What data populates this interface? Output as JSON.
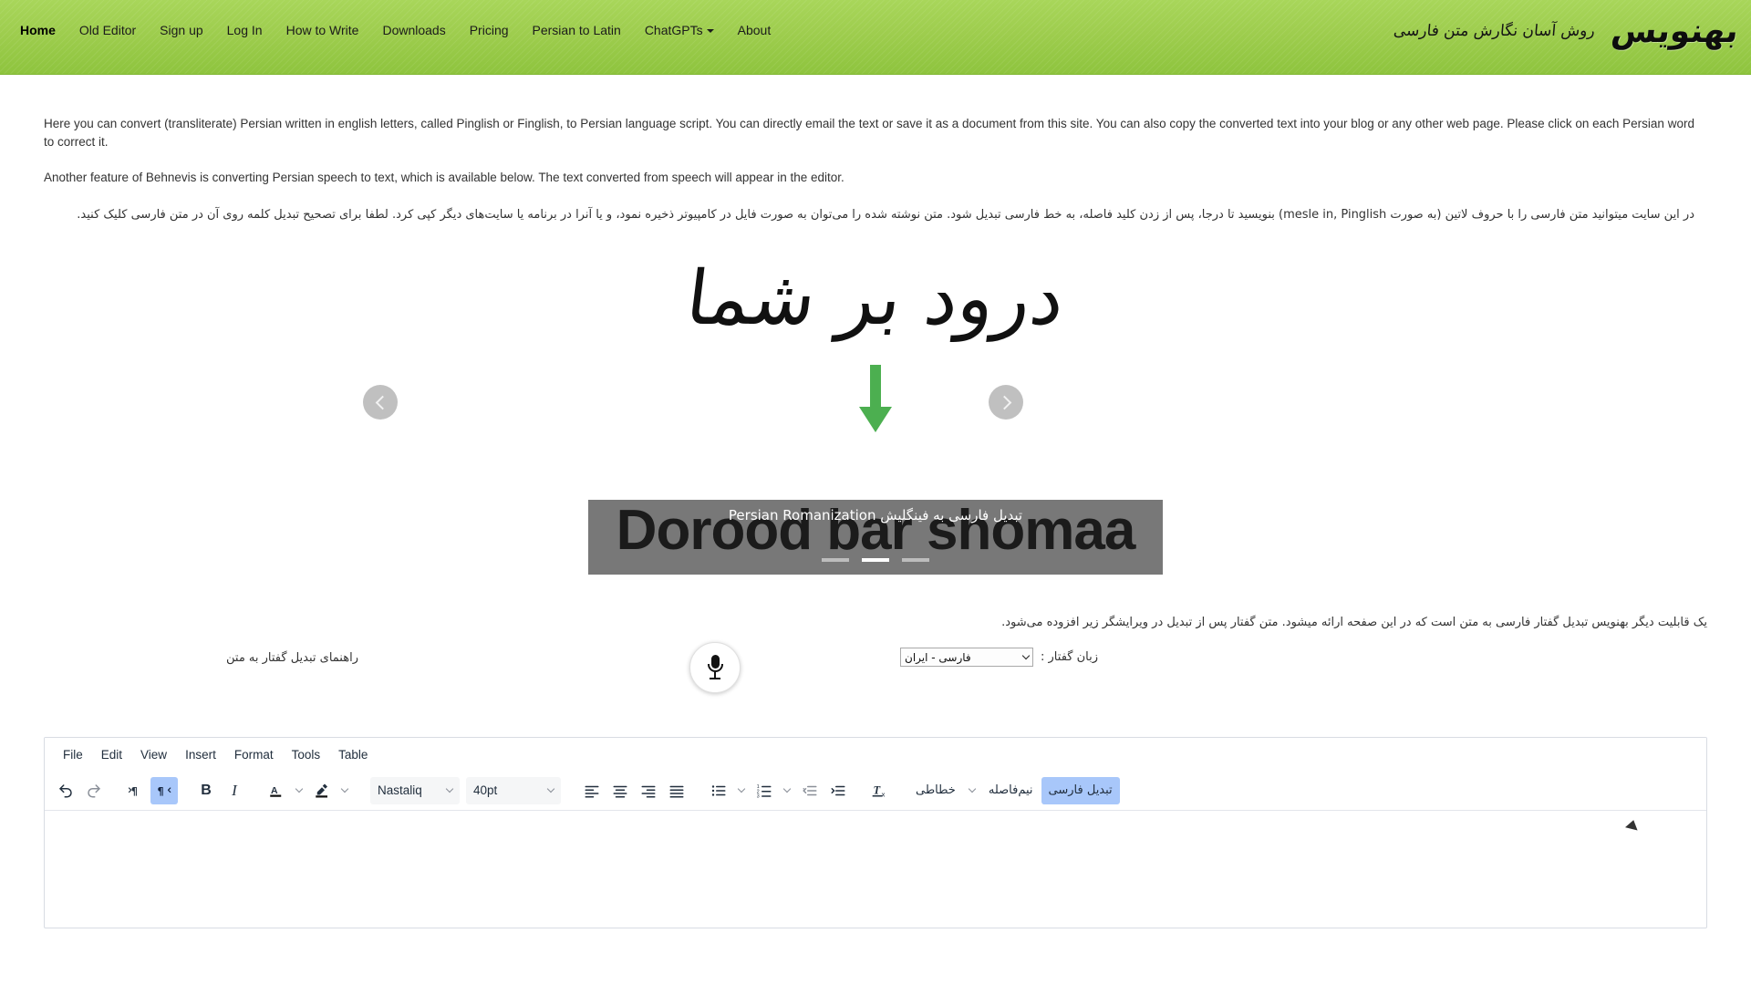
{
  "navbar": {
    "items": [
      {
        "label": "Home",
        "active": true,
        "dropdown": false
      },
      {
        "label": "Old Editor",
        "active": false,
        "dropdown": false
      },
      {
        "label": "Sign up",
        "active": false,
        "dropdown": false
      },
      {
        "label": "Log In",
        "active": false,
        "dropdown": false
      },
      {
        "label": "How to Write",
        "active": false,
        "dropdown": false
      },
      {
        "label": "Downloads",
        "active": false,
        "dropdown": false
      },
      {
        "label": "Pricing",
        "active": false,
        "dropdown": false
      },
      {
        "label": "Persian to Latin",
        "active": false,
        "dropdown": false
      },
      {
        "label": "ChatGPTs",
        "active": false,
        "dropdown": true
      },
      {
        "label": "About",
        "active": false,
        "dropdown": false
      }
    ],
    "brand": {
      "logo": "بهنویس",
      "tagline": "روش آسان نگارش متن فارسی"
    },
    "background_color": "#9ecd4e"
  },
  "intro": {
    "paragraph_1": "Here you can convert (transliterate) Persian written in english letters, called Pinglish or Finglish, to Persian language script. You can directly email the text or save it as a document from this site. You can also copy the converted text into your blog or any other web page. Please click on each Persian word to correct it.",
    "paragraph_2": "Another feature of Behnevis is converting Persian speech to text, which is available below. The text converted from speech will appear in the editor.",
    "paragraph_fa": "در این سایت میتوانید متن فارسی را با حروف لاتین (به صورت mesle in, Pinglish) بنویسید تا درجا، پس از زدن کلید فاصله، به خط فارسی تبدیل شود. متن نوشته شده را می‌توان به صورت فایل در کامپیوتر ذخیره نمود، و یا آنرا در برنامه یا سایت‌های دیگر کپی کرد. لطفا برای تصحیح تبدیل کلمه روی آن در متن فارسی کلیک کنید."
  },
  "carousel": {
    "slide_persian": "درود بر شما",
    "slide_caption_fa": "تبدیل فارسی به فینگلیش",
    "slide_caption_en": "Persian Romanization",
    "slide_romanization": "Dorood bar shomaa",
    "dots": [
      {
        "active": false
      },
      {
        "active": true
      },
      {
        "active": false
      }
    ],
    "prev_icon": "chevron-left-icon",
    "next_icon": "chevron-right-icon",
    "arrow_color": "#4caf50"
  },
  "speech": {
    "note_fa": "یک قابلیت دیگر بهنویس تبدیل گفتار فارسی به متن است که در این صفحه ارائه میشود. متن گفتار پس از تبدیل در ویرایشگر زیر افزوده می‌شود.",
    "guide_link_fa": "راهنمای تبدیل گفتار به متن",
    "mic_icon": "microphone-icon",
    "language_label_fa": "زبان گفتار :",
    "language_value_fa": "فارسی - ایران"
  },
  "editor": {
    "menus": [
      "File",
      "Edit",
      "View",
      "Insert",
      "Format",
      "Tools",
      "Table"
    ],
    "toolbar": {
      "undo_icon": "undo-icon",
      "redo_icon": "redo-icon",
      "ltr_icon": "ltr-paragraph-icon",
      "rtl_icon": "rtl-paragraph-icon",
      "rtl_active": true,
      "bold_label": "B",
      "italic_label": "I",
      "text_color_label": "A",
      "highlight_icon": "highlighter-icon",
      "font_family": "Nastaliq",
      "font_size": "40pt",
      "align_left_icon": "align-left-icon",
      "align_center_icon": "align-center-icon",
      "align_right_icon": "align-right-icon",
      "align_justify_icon": "align-justify-icon",
      "bullet_list_icon": "bullet-list-icon",
      "numbered_list_icon": "numbered-list-icon",
      "outdent_icon": "outdent-icon",
      "indent_icon": "indent-icon",
      "clear_format_label": "Tx",
      "calligraphy_fa": "خطاطی",
      "halfspace_fa": "نیم‌فاصله",
      "convert_fa": "تبدیل فارسی",
      "convert_active": true,
      "active_bg_color": "#a8c7fa"
    }
  }
}
